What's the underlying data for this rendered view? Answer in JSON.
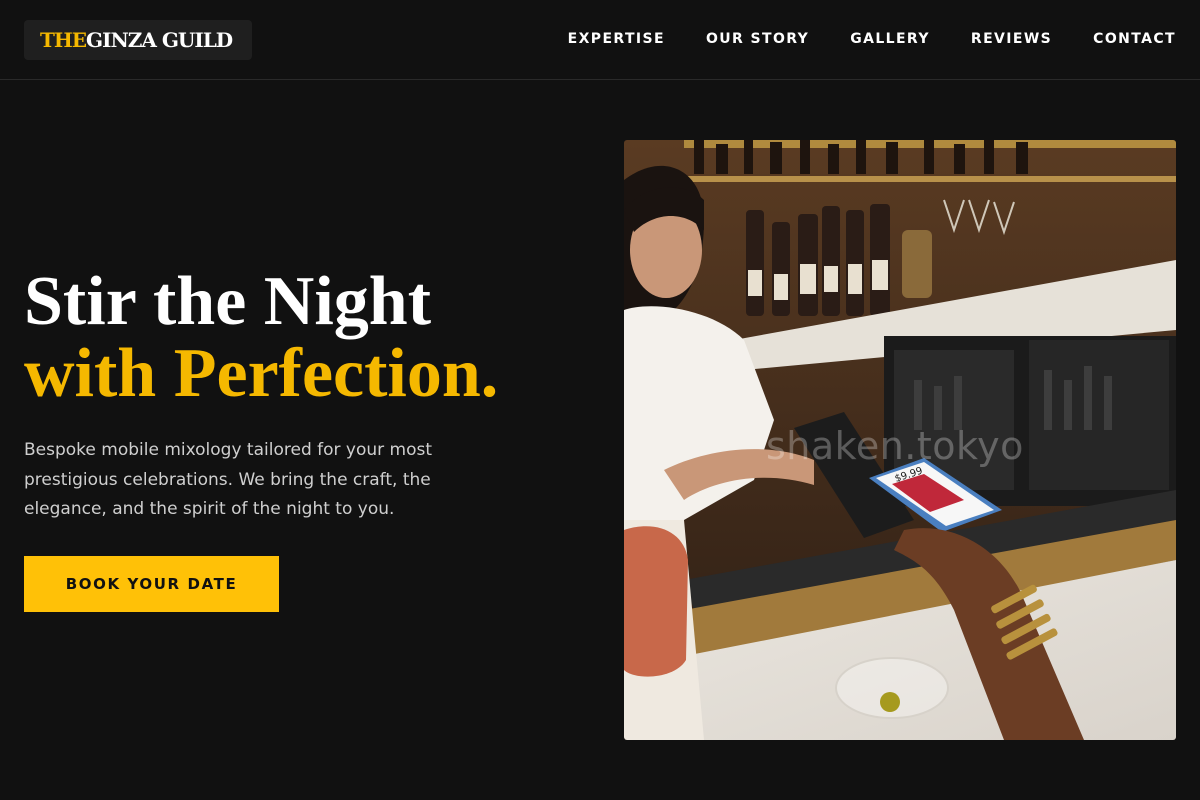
{
  "brand": {
    "prefix": "THE",
    "name": "GINZA GUILD"
  },
  "nav": {
    "items": [
      {
        "label": "EXPERTISE"
      },
      {
        "label": "OUR STORY"
      },
      {
        "label": "GALLERY"
      },
      {
        "label": "REVIEWS"
      },
      {
        "label": "CONTACT"
      }
    ]
  },
  "hero": {
    "title_line1": "Stir the Night",
    "title_line2": "with Perfection.",
    "description": "Bespoke mobile mixology tailored for your most prestigious celebrations. We bring the craft, the elegance, and the spirit of the night to you.",
    "cta_label": "BOOK YOUR DATE"
  },
  "photo": {
    "watermark": "shaken.tokyo",
    "screen_amount": "$9.99"
  },
  "colors": {
    "accent": "#ffc107",
    "background": "#111111",
    "heading_accent": "#f5b800"
  }
}
